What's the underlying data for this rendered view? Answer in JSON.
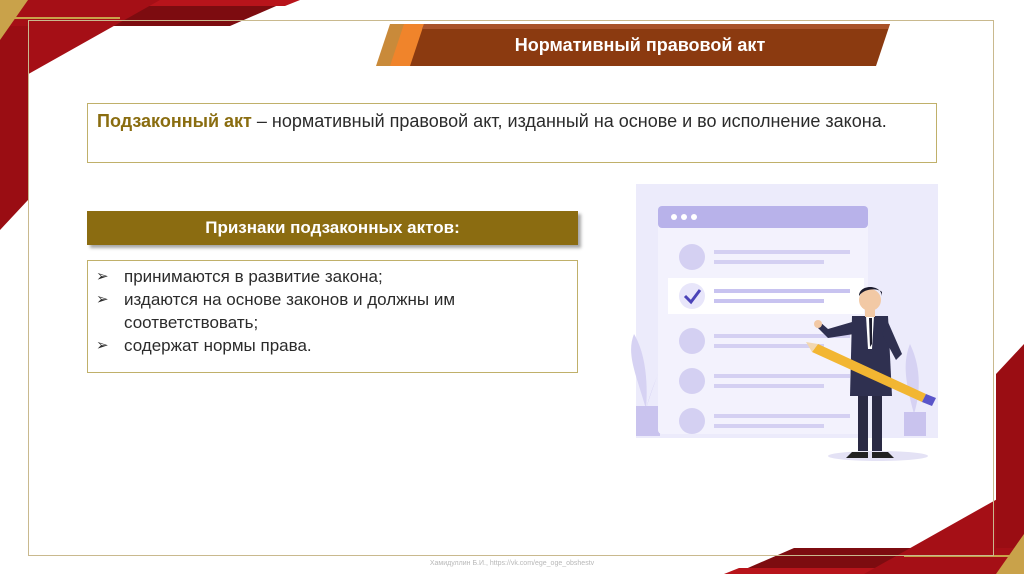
{
  "slide": {
    "title": "Нормативный правовой акт",
    "definition": {
      "term": "Подзаконный акт",
      "text": " – нормативный правовой акт, изданный на основе и во исполнение закона."
    },
    "signs_header": "Признаки подзаконных актов:",
    "signs": [
      {
        "bullet": "➢",
        "text": "принимаются в развитие закона;"
      },
      {
        "bullet": "➢",
        "text": "издаются на основе законов и должны им соответствовать;"
      },
      {
        "bullet": "➢",
        "text": "содержат нормы права."
      }
    ],
    "footer": "Хамидуллин Б.И., https://vk.com/ege_oge_obshestv"
  },
  "colors": {
    "dark_red": "#8e0e12",
    "red": "#c4161c",
    "gold": "#c9a24a",
    "title_brown": "#8b3a10",
    "orange": "#f0842b",
    "header_olive": "#8b6c11",
    "illustration_lavender": "#d9d6f5",
    "illustration_purple": "#b8b2ea"
  }
}
